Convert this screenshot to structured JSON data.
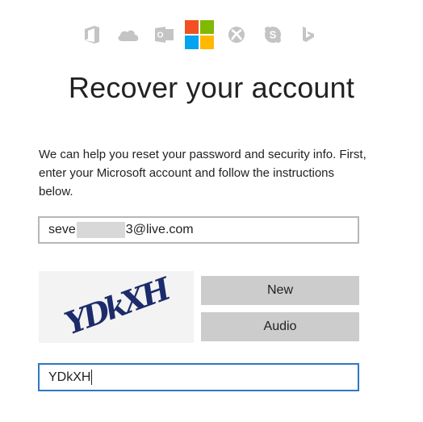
{
  "header": {
    "icons": [
      "office-icon",
      "onedrive-icon",
      "outlook-icon",
      "microsoft-logo",
      "xbox-icon",
      "skype-icon",
      "bing-icon"
    ],
    "logo_colors": [
      "#f25022",
      "#7fba00",
      "#00a4ef",
      "#ffb900"
    ],
    "outlook_letter": "O",
    "skype_letter": "S",
    "bing_letter": "b"
  },
  "page": {
    "title": "Recover your account",
    "description": "We can help you reset your password and security info. First, enter your Microsoft account and follow the instructions below."
  },
  "form": {
    "email_prefix": "seve",
    "email_suffix": "3@live.com",
    "captcha_text": "YDkXH",
    "new_button": "New",
    "audio_button": "Audio",
    "captcha_input_value": "YDkXH"
  },
  "colors": {
    "accent": "#2f77c4",
    "button_bg": "#cccccc",
    "icon_gray": "#c4c4c4",
    "captcha_ink": "#1c2b6b"
  }
}
